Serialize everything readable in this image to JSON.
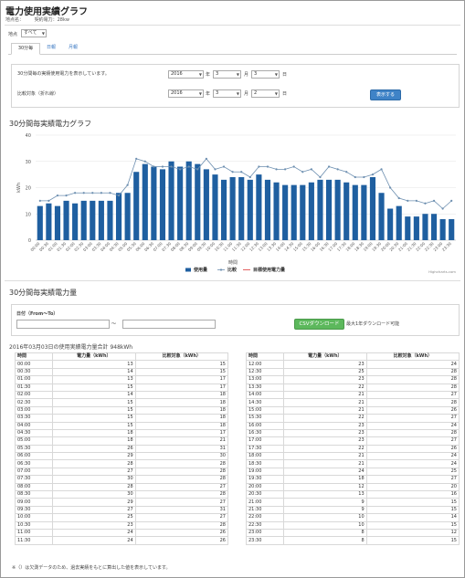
{
  "header": {
    "title": "電力使用実績グラフ",
    "site_label": "地点名：",
    "contract_label": "契約電力：28kw"
  },
  "site_select": {
    "label": "地点",
    "value": "すべて"
  },
  "tabs": [
    {
      "label": "30分毎",
      "active": true
    },
    {
      "label": "日報",
      "active": false
    },
    {
      "label": "月報",
      "active": false
    }
  ],
  "form": {
    "row1_label": "30分間毎の実績使用電力を表示しています。",
    "row2_label": "比較対象（折れ線）",
    "year1": "2016",
    "month1": "3",
    "day1": "3",
    "year2": "2016",
    "month2": "3",
    "day2": "2",
    "year_unit": "年",
    "month_unit": "月",
    "day_unit": "日",
    "show_button": "表示する"
  },
  "chart_section_title": "30分間毎実績電力グラフ",
  "chart_data": {
    "type": "bar",
    "title": "",
    "ylabel": "kWh",
    "xlabel": "時間",
    "ylim": [
      0,
      40
    ],
    "yticks": [
      "0",
      "10",
      "20",
      "30",
      "40"
    ],
    "categories": [
      "00:00",
      "00:30",
      "01:00",
      "01:30",
      "02:00",
      "02:30",
      "03:00",
      "03:30",
      "04:00",
      "04:30",
      "05:00",
      "05:30",
      "06:00",
      "06:30",
      "07:00",
      "07:30",
      "08:00",
      "08:30",
      "09:00",
      "09:30",
      "10:00",
      "10:30",
      "11:00",
      "11:30",
      "12:00",
      "12:30",
      "13:00",
      "13:30",
      "14:00",
      "14:30",
      "15:00",
      "15:30",
      "16:00",
      "16:30",
      "17:00",
      "17:30",
      "18:00",
      "18:30",
      "19:00",
      "19:30",
      "20:00",
      "20:30",
      "21:00",
      "21:30",
      "22:00",
      "22:30",
      "23:00",
      "23:30"
    ],
    "series": [
      {
        "name": "使用量",
        "type": "bar",
        "color": "#1f5fa0",
        "values": [
          13,
          14,
          13,
          15,
          14,
          15,
          15,
          15,
          15,
          18,
          18,
          26,
          29,
          28,
          27,
          30,
          28,
          30,
          29,
          27,
          25,
          23,
          24,
          24,
          23,
          25,
          23,
          22,
          21,
          21,
          21,
          22,
          23,
          23,
          23,
          22,
          21,
          21,
          24,
          18,
          12,
          13,
          9,
          9,
          10,
          10,
          8,
          8
        ]
      },
      {
        "name": "比較",
        "type": "line",
        "color": "#6d8fb0",
        "values": [
          15,
          15,
          17,
          17,
          18,
          18,
          18,
          18,
          18,
          17,
          21,
          31,
          30,
          28,
          28,
          28,
          27,
          28,
          27,
          31,
          27,
          28,
          26,
          26,
          24,
          28,
          28,
          27,
          27,
          28,
          26,
          27,
          24,
          28,
          27,
          26,
          24,
          24,
          25,
          27,
          20,
          16,
          15,
          15,
          14,
          15,
          12,
          15
        ]
      },
      {
        "name": "目標使用電力量",
        "type": "line",
        "color": "#e05050",
        "values": []
      }
    ],
    "credit": "Highcharts.com"
  },
  "energy_section_title": "30分間毎実績電力量",
  "date_filter": {
    "label": "日付（From～To）",
    "tilde": "～"
  },
  "csv": {
    "button": "CSVダウンロード",
    "note": "最大1年ダウンロード可能"
  },
  "total_text": "2016年03月03日の使用実績電力量合計 948kWh",
  "table": {
    "headers": [
      "時間",
      "電力量（kWh）",
      "比較対象（kWh）"
    ],
    "left_rows": [
      [
        "00:00",
        "13",
        "15"
      ],
      [
        "00:30",
        "14",
        "15"
      ],
      [
        "01:00",
        "13",
        "17"
      ],
      [
        "01:30",
        "15",
        "17"
      ],
      [
        "02:00",
        "14",
        "18"
      ],
      [
        "02:30",
        "15",
        "18"
      ],
      [
        "03:00",
        "15",
        "18"
      ],
      [
        "03:30",
        "15",
        "18"
      ],
      [
        "04:00",
        "15",
        "18"
      ],
      [
        "04:30",
        "18",
        "17"
      ],
      [
        "05:00",
        "18",
        "21"
      ],
      [
        "05:30",
        "26",
        "31"
      ],
      [
        "06:00",
        "29",
        "30"
      ],
      [
        "06:30",
        "28",
        "28"
      ],
      [
        "07:00",
        "27",
        "28"
      ],
      [
        "07:30",
        "30",
        "28"
      ],
      [
        "08:00",
        "28",
        "27"
      ],
      [
        "08:30",
        "30",
        "28"
      ],
      [
        "09:00",
        "29",
        "27"
      ],
      [
        "09:30",
        "27",
        "31"
      ],
      [
        "10:00",
        "25",
        "27"
      ],
      [
        "10:30",
        "23",
        "28"
      ],
      [
        "11:00",
        "24",
        "26"
      ],
      [
        "11:30",
        "24",
        "26"
      ]
    ],
    "right_rows": [
      [
        "12:00",
        "23",
        "24"
      ],
      [
        "12:30",
        "25",
        "28"
      ],
      [
        "13:00",
        "23",
        "28"
      ],
      [
        "13:30",
        "22",
        "28"
      ],
      [
        "14:00",
        "21",
        "27"
      ],
      [
        "14:30",
        "21",
        "28"
      ],
      [
        "15:00",
        "21",
        "26"
      ],
      [
        "15:30",
        "22",
        "27"
      ],
      [
        "16:00",
        "23",
        "24"
      ],
      [
        "16:30",
        "23",
        "28"
      ],
      [
        "17:00",
        "23",
        "27"
      ],
      [
        "17:30",
        "22",
        "26"
      ],
      [
        "18:00",
        "21",
        "24"
      ],
      [
        "18:30",
        "21",
        "24"
      ],
      [
        "19:00",
        "24",
        "25"
      ],
      [
        "19:30",
        "18",
        "27"
      ],
      [
        "20:00",
        "12",
        "20"
      ],
      [
        "20:30",
        "13",
        "16"
      ],
      [
        "21:00",
        "9",
        "15"
      ],
      [
        "21:30",
        "9",
        "15"
      ],
      [
        "22:00",
        "10",
        "14"
      ],
      [
        "22:30",
        "10",
        "15"
      ],
      [
        "23:00",
        "8",
        "12"
      ],
      [
        "23:30",
        "8",
        "15"
      ]
    ]
  },
  "footnote": "※（）は欠測データのため、過去実績をもとに算出した値を表示しています。"
}
